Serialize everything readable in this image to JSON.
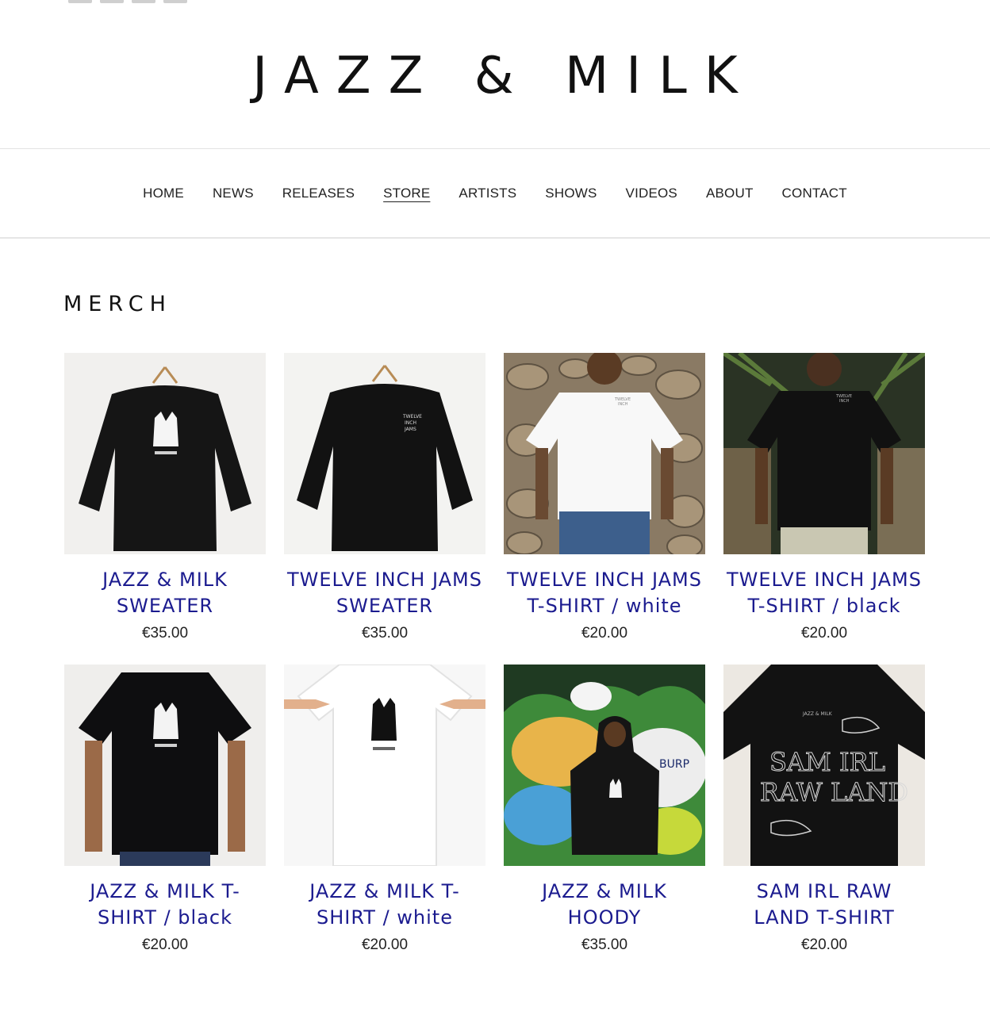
{
  "header": {
    "logo_text": "JAZZ & MILK"
  },
  "nav": {
    "items": [
      {
        "label": "HOME",
        "active": false
      },
      {
        "label": "NEWS",
        "active": false
      },
      {
        "label": "RELEASES",
        "active": false
      },
      {
        "label": "STORE",
        "active": true
      },
      {
        "label": "ARTISTS",
        "active": false
      },
      {
        "label": "SHOWS",
        "active": false
      },
      {
        "label": "VIDEOS",
        "active": false
      },
      {
        "label": "ABOUT",
        "active": false
      },
      {
        "label": "CONTACT",
        "active": false
      }
    ]
  },
  "main": {
    "title": "MERCH",
    "products": [
      {
        "name": "JAZZ & MILK SWEATER",
        "price": "€35.00",
        "image": "black-sweater-jazz-milk-logo"
      },
      {
        "name": "TWELVE INCH JAMS SWEATER",
        "price": "€35.00",
        "image": "black-sweater-twelve-inch-jams"
      },
      {
        "name": "TWELVE INCH JAMS T-SHIRT / white",
        "price": "€20.00",
        "image": "white-tshirt-stone-wall"
      },
      {
        "name": "TWELVE INCH JAMS T-SHIRT / black",
        "price": "€20.00",
        "image": "black-tshirt-palm"
      },
      {
        "name": "JAZZ & MILK T-SHIRT / black",
        "price": "€20.00",
        "image": "black-tshirt-jazz-milk-logo"
      },
      {
        "name": "JAZZ & MILK T-SHIRT / white",
        "price": "€20.00",
        "image": "white-tshirt-jazz-milk-logo"
      },
      {
        "name": "JAZZ & MILK HOODY",
        "price": "€35.00",
        "image": "black-hoody-graffiti"
      },
      {
        "name": "SAM IRL RAW LAND T-SHIRT",
        "price": "€20.00",
        "image": "black-tshirt-sam-irl-raw-land"
      }
    ]
  },
  "colors": {
    "product_name": "#1b1b8f",
    "text": "#222222",
    "divider": "#e3e3e3"
  }
}
